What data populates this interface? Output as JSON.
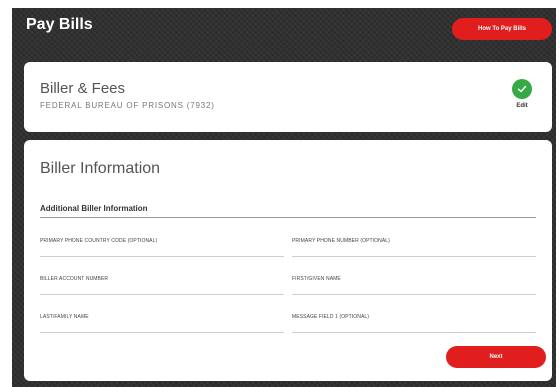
{
  "header": {
    "title": "Pay Bills",
    "how_to_label": "How To Pay Bills"
  },
  "fees_card": {
    "title": "Biller & Fees",
    "biller_name": "FEDERAL BUREAU OF PRISONS (7932)",
    "edit_label": "Edit",
    "status_icon": "check-icon",
    "status_color": "#35a946"
  },
  "info_card": {
    "title": "Biller Information",
    "section_heading": "Additional Biller Information",
    "fields": [
      {
        "label": "PRIMARY PHONE COUNTRY CODE (OPTIONAL)",
        "value": ""
      },
      {
        "label": "PRIMARY PHONE NUMBER (OPTIONAL)",
        "value": ""
      },
      {
        "label": "BILLER ACCOUNT NUMBER",
        "value": ""
      },
      {
        "label": "FIRST/GIVEN NAME",
        "value": ""
      },
      {
        "label": "LAST/FAMILY NAME",
        "value": ""
      },
      {
        "label": "MESSAGE FIELD 1 (OPTIONAL)",
        "value": ""
      }
    ],
    "next_label": "Next"
  },
  "colors": {
    "accent": "#e01e1e",
    "background": "#2e2e2e"
  }
}
